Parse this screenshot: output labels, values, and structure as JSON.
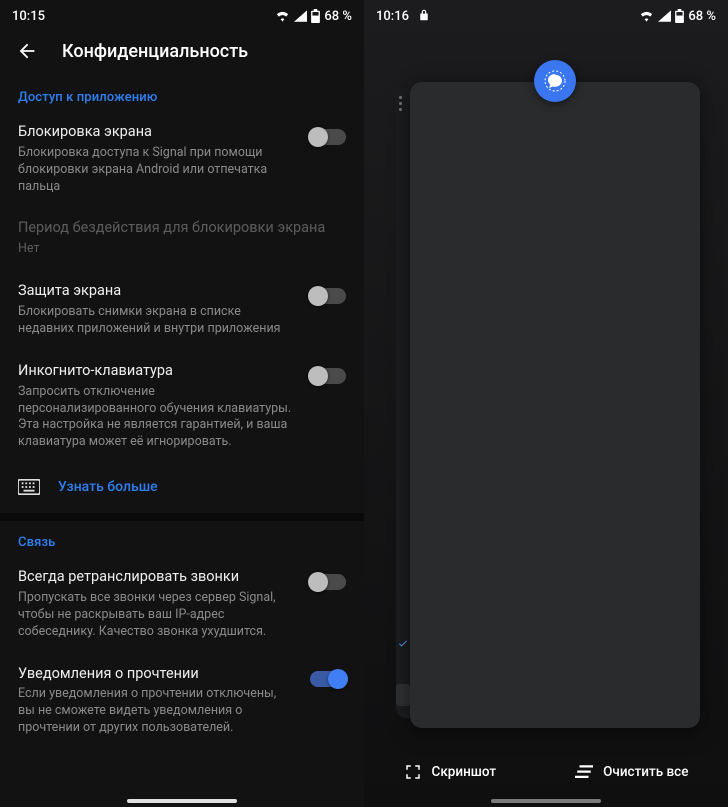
{
  "left": {
    "status": {
      "time": "10:15",
      "battery": "68 %"
    },
    "header_title": "Конфиденциальность",
    "section_access": "Доступ к приложению",
    "screen_lock": {
      "title": "Блокировка экрана",
      "sub": "Блокировка доступа к Signal при помощи блокировки экрана Android или отпечатка пальца",
      "on": false
    },
    "inactivity": {
      "title": "Период бездействия для блокировки экрана",
      "sub": "Нет"
    },
    "screen_security": {
      "title": "Защита экрана",
      "sub": "Блокировать снимки экрана в списке недавних приложений и внутри приложения",
      "on": false
    },
    "incognito": {
      "title": "Инкогнито-клавиатура",
      "sub": "Запросить отключение персонализированного обучения клавиатуры. Эта настройка не является гарантией, и ваша клавиатура может её игнорировать.",
      "on": false
    },
    "learn_more": "Узнать больше",
    "section_comm": "Связь",
    "relay": {
      "title": "Всегда ретранслировать звонки",
      "sub": "Пропускать все звонки через сервер Signal, чтобы не раскрывать ваш IP-адрес собеседнику. Качество звонка ухудшится.",
      "on": false
    },
    "read_receipts": {
      "title": "Уведомления о прочтении",
      "sub": "Если уведомления о прочтении отключены, вы не сможете видеть уведомления о прочтении от других пользователей.",
      "on": true
    }
  },
  "right": {
    "status": {
      "time": "10:16",
      "battery": "68 %"
    },
    "screenshot": "Скриншот",
    "clear_all": "Очистить все"
  }
}
